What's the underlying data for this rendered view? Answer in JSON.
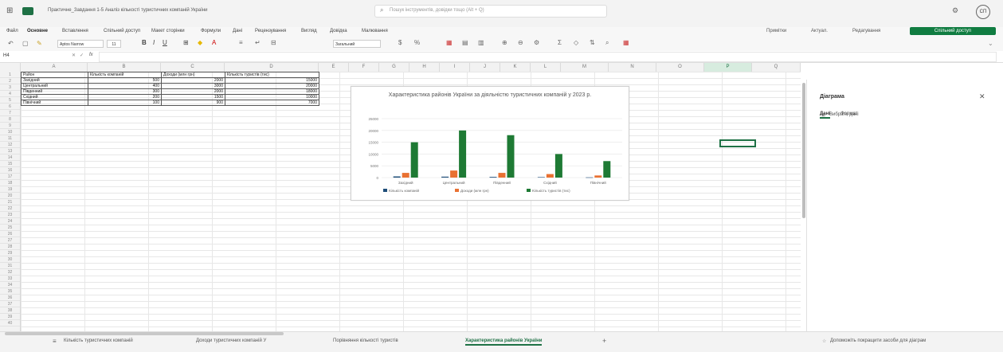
{
  "titlebar": {
    "title": "Практичне_Завдання 1-5 Аналіз кількості туристичних компаній України",
    "search_placeholder": "Пошук інструментів, довідки тощо (Alt + Q)",
    "avatar_initials": "СП"
  },
  "ribbon": {
    "tabs": [
      "Файл",
      "Основне",
      "Вставлення",
      "Спільний доступ",
      "Макет сторінки",
      "Формули",
      "Дані",
      "Рецензування",
      "Вигляд",
      "Довідка",
      "Малювання"
    ],
    "active_tab": "Основне",
    "right_buttons": {
      "comments": "Примітки",
      "catch_up": "Актуал.",
      "editing": "Редагування",
      "share": "Спільний доступ"
    },
    "font_name": "Aptos Narrow",
    "font_size": "11",
    "number_format": "Загальний"
  },
  "formula": {
    "name_box": "H4",
    "fx": "fx"
  },
  "columns": [
    "A",
    "B",
    "C",
    "D",
    "E",
    "F",
    "G",
    "H",
    "I",
    "J",
    "K",
    "L",
    "M",
    "N",
    "O",
    "P",
    "Q"
  ],
  "rows": [
    "1",
    "2",
    "3",
    "4",
    "5",
    "6",
    "7",
    "8",
    "9",
    "10",
    "11",
    "12",
    "13",
    "14",
    "15",
    "16",
    "17",
    "18",
    "19",
    "20",
    "21",
    "22",
    "23",
    "24",
    "25",
    "26",
    "27",
    "28",
    "29",
    "30",
    "31",
    "32",
    "33",
    "34",
    "35",
    "36",
    "37",
    "38",
    "39",
    "40"
  ],
  "table": {
    "headers": [
      "Район",
      "Кількість компаній",
      "Доходи (млн грн)",
      "Кількість туристів (тис)"
    ],
    "rows": [
      [
        "Західний",
        "500",
        "2000",
        "15000"
      ],
      [
        "Центральний",
        "400",
        "3000",
        "20000"
      ],
      [
        "Південний",
        "300",
        "2000",
        "18000"
      ],
      [
        "Східний",
        "200",
        "1500",
        "10000"
      ],
      [
        "Північний",
        "100",
        "900",
        "7000"
      ]
    ]
  },
  "chart_data": {
    "type": "bar",
    "title": "Характеристика районів України за діяльністю туристичних компаній у 2023 р.",
    "categories": [
      "Західний",
      "Центральний",
      "Південний",
      "Східний",
      "Північний"
    ],
    "series": [
      {
        "name": "Кількість компаній",
        "values": [
          500,
          400,
          300,
          200,
          100
        ],
        "color": "#1f4e79"
      },
      {
        "name": "Доходи (млн грн)",
        "values": [
          2000,
          3000,
          2000,
          1500,
          900
        ],
        "color": "#e97132"
      },
      {
        "name": "Кількість туристів (тис)",
        "values": [
          15000,
          20000,
          18000,
          10000,
          7000
        ],
        "color": "#1e7a34"
      }
    ],
    "yticks": [
      "25000",
      "20000",
      "15000",
      "10000",
      "5000",
      "0"
    ],
    "ylim": [
      0,
      25000
    ],
    "legend": "bottom"
  },
  "pane": {
    "title": "Діаграма",
    "tabs": [
      "Дані",
      "Формат"
    ],
    "active_tab": "Дані",
    "item": "Вибрати дані",
    "footer": "Допоможіть покращити засоби для діаграм"
  },
  "sheets": {
    "tabs": [
      "Кількість туристичних компаній",
      "Доходи туристичних компаній У",
      "Порівняння кількості туристів",
      "Характеристика районів України"
    ],
    "active": "Характеристика районів України"
  },
  "colors": {
    "accent": "#1e7145",
    "share_bg": "#107c41"
  }
}
